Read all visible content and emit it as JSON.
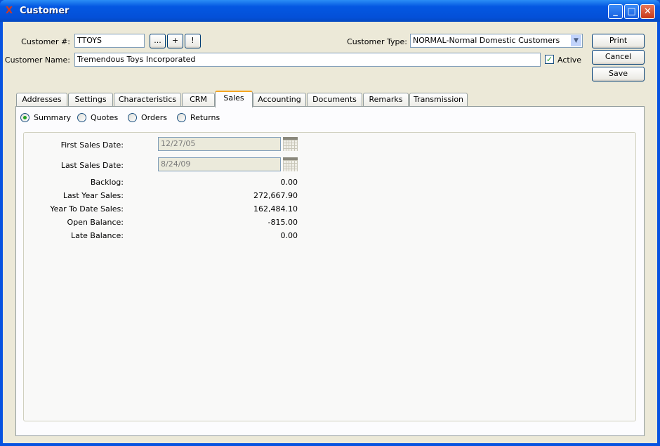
{
  "window": {
    "title": "Customer",
    "logo": "X"
  },
  "header": {
    "customer_number_label": "Customer #:",
    "customer_number": "TTOYS",
    "lookup_button": "...",
    "new_button": "+",
    "alert_button": "!",
    "customer_name_label": "Customer Name:",
    "customer_name": "Tremendous Toys Incorporated",
    "customer_type_label": "Customer Type:",
    "customer_type": "NORMAL-Normal Domestic Customers",
    "active_label": "Active",
    "active_checked": true
  },
  "actions": {
    "print": "Print",
    "cancel": "Cancel",
    "save": "Save"
  },
  "tabs": [
    "Addresses",
    "Settings",
    "Characteristics",
    "CRM",
    "Sales",
    "Accounting",
    "Documents",
    "Remarks",
    "Transmission"
  ],
  "active_tab": "Sales",
  "views": [
    "Summary",
    "Quotes",
    "Orders",
    "Returns"
  ],
  "selected_view": "Summary",
  "summary": {
    "first_sales_date_label": "First Sales Date:",
    "first_sales_date": "12/27/05",
    "last_sales_date_label": "Last Sales Date:",
    "last_sales_date": "8/24/09",
    "rows": [
      {
        "label": "Backlog:",
        "value": "0.00"
      },
      {
        "label": "Last Year Sales:",
        "value": "272,667.90"
      },
      {
        "label": "Year To Date Sales:",
        "value": "162,484.10"
      },
      {
        "label": "Open Balance:",
        "value": "-815.00"
      },
      {
        "label": "Late Balance:",
        "value": "0.00"
      }
    ]
  }
}
